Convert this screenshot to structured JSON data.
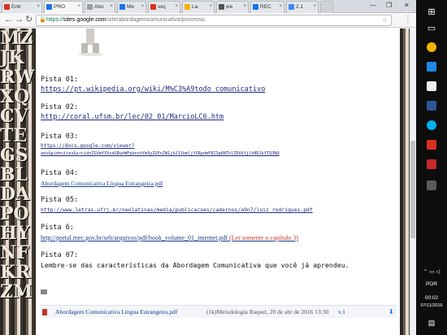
{
  "tabs": [
    {
      "label": "Entr",
      "favicon": "gmail-icon",
      "color": "#d93025"
    },
    {
      "label": "PRO",
      "favicon": "sites-icon",
      "color": "#1a73e8"
    },
    {
      "label": "Abo",
      "favicon": "document-icon",
      "color": "#9e9e9e"
    },
    {
      "label": "Me",
      "favicon": "sites-icon",
      "color": "#1a73e8"
    },
    {
      "label": "seç",
      "favicon": "pdf-icon",
      "color": "#d93025"
    },
    {
      "label": "La",
      "favicon": "la-icon",
      "color": "#f4b400"
    },
    {
      "label": "we",
      "favicon": "page-icon",
      "color": "#555555"
    },
    {
      "label": "REC",
      "favicon": "sites-icon",
      "color": "#1a73e8"
    },
    {
      "label": "2.1",
      "favicon": "google-icon",
      "color": "#4285f4"
    }
  ],
  "window_controls": {
    "minimize": "—",
    "maximize": "❐",
    "close": "✕"
  },
  "toolbar": {
    "back": "←",
    "forward": "→",
    "reload": "↻",
    "url_scheme": "https://",
    "url_host": "sites.google.com",
    "url_path": "/site/abordagemcomunicativa/processo",
    "star": "☆",
    "menu": "⋮"
  },
  "pistas": [
    {
      "label": "Pista 01:",
      "link": "https://pt.wikipedia.org/wiki/M%C3%A9todo_comunicativo"
    },
    {
      "label": "Pista 02:",
      "link": "http://coral.ufsm.br/lec/02_01/MarcioLC6.htm"
    },
    {
      "label": "Pista 03:",
      "link_line1": "https://docs.google.com/viewer?",
      "link_line2": "a=v&pid=sites&srcid=ZGVmYXVsdGRvbWFpbnxhYm9yZGFnZW1jb211bmljYXRpdmF8Z3g6NThlZDVkYjlhNDJkYTQ3NQ"
    },
    {
      "label": "Pista 04:",
      "link": "Abordagem Comunicativa Língua Estrangeira.pdf"
    },
    {
      "label": "Pista 05:",
      "link": "http://www.letras.ufrj.br/neolatinas/media/publicacoes/cadernos/a9n7/luiz_rodrigues.pdf"
    },
    {
      "label": "Pista 6:",
      "link": "http://portal.mec.gov.br/seb/arquivos/pdf/book_volume_01_internet.pdf",
      "note": " (Ler somente o capítulo 3)"
    },
    {
      "label": "Pista 07:",
      "text": "Lembre-se das características da Abordagem Comunicativa que você já aprendeu."
    }
  ],
  "attachment": {
    "name": "Abordagem Comunicativa Língua Estrangeira.pdf",
    "meta": "(1k)Metodologia Raquel, 20 de abr de 2016 13:30",
    "version": "v.1",
    "download": "⬇"
  },
  "taskbar": {
    "language": "POR",
    "time": "00:02",
    "date": "07/11/2016"
  },
  "colors": {
    "link": "#222a7a",
    "red_note": "#c0392b",
    "taskbar": "#0d0d0d"
  }
}
